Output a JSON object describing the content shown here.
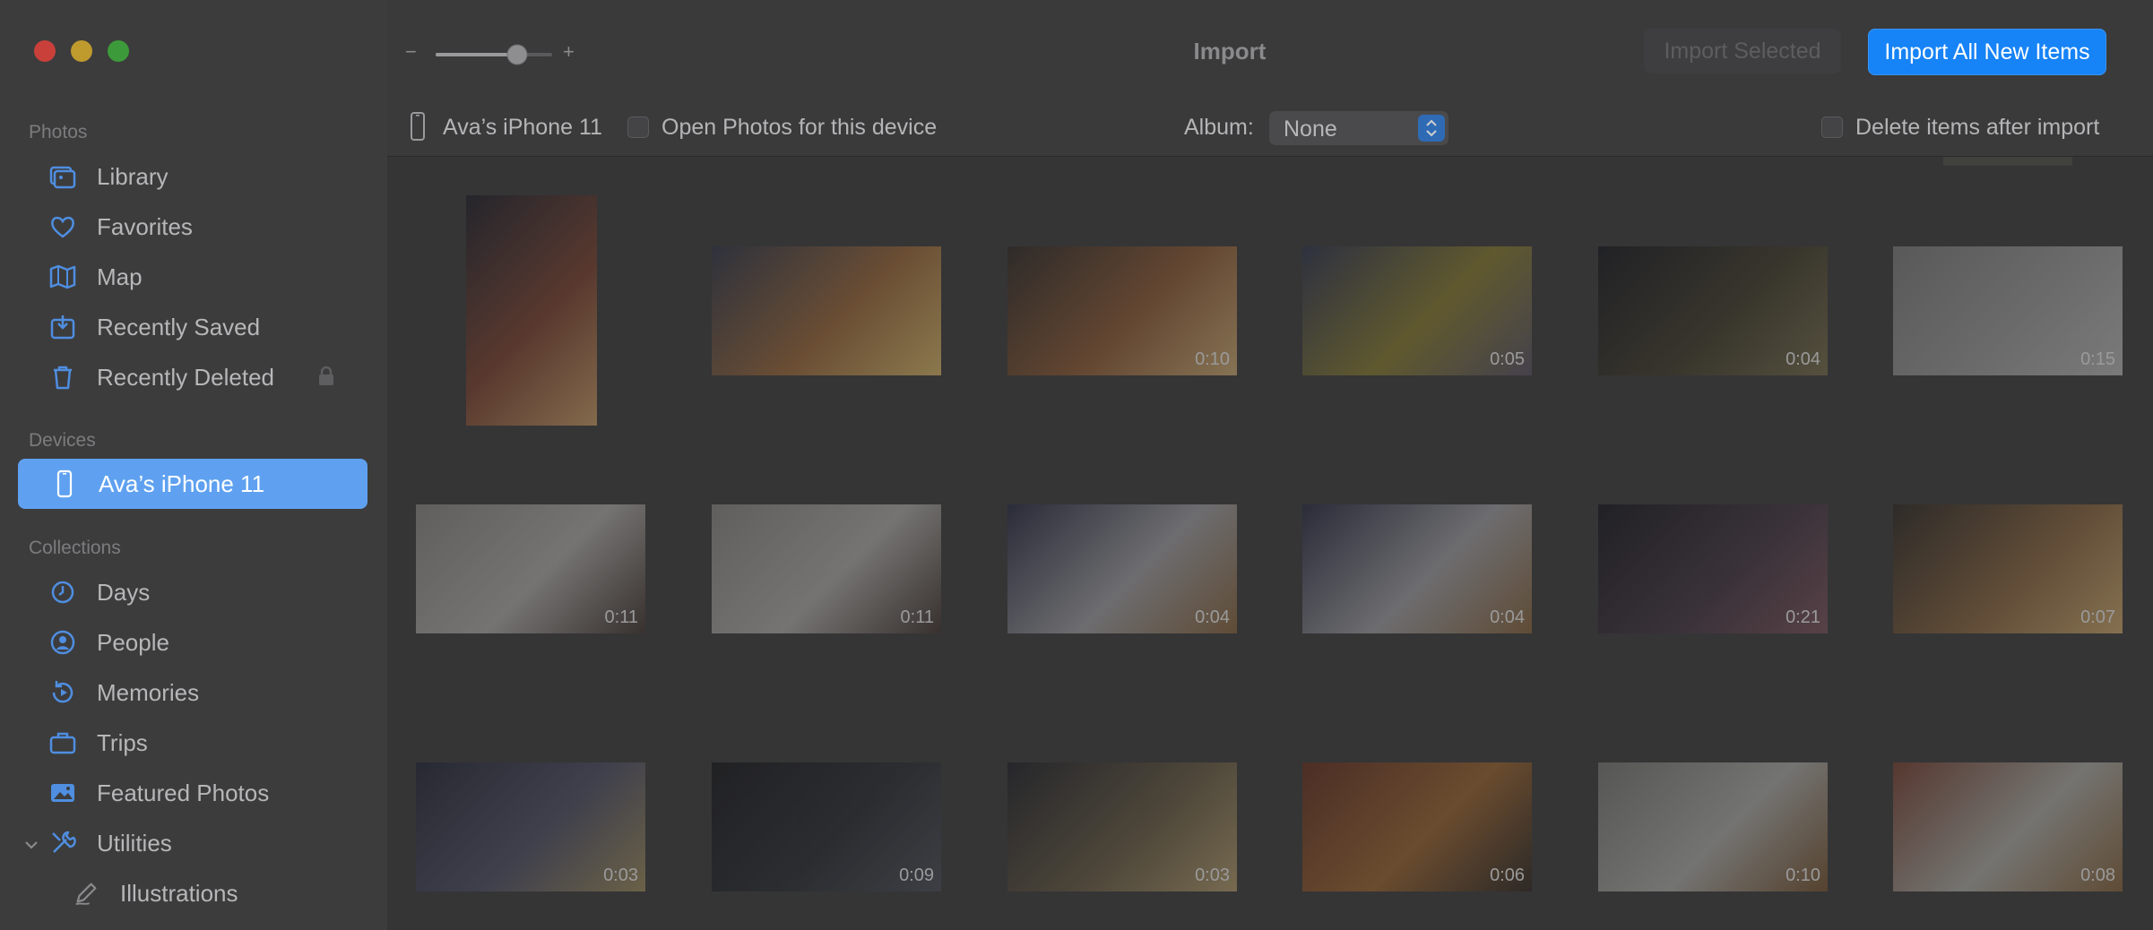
{
  "window": {
    "title": "Import"
  },
  "toolbar": {
    "zoom_minus": "−",
    "zoom_plus": "+",
    "zoom_level": 0.7,
    "import_selected_label": "Import Selected",
    "import_all_label": "Import All New Items"
  },
  "subbar": {
    "device_name": "Ava’s iPhone 11",
    "open_photos_label": "Open Photos for this device",
    "album_label": "Album:",
    "album_value": "None",
    "delete_after_label": "Delete items after import"
  },
  "sidebar": {
    "photos_header": "Photos",
    "photos_items": [
      {
        "label": "Library",
        "icon": "library-icon"
      },
      {
        "label": "Favorites",
        "icon": "heart-icon"
      },
      {
        "label": "Map",
        "icon": "map-icon"
      },
      {
        "label": "Recently Saved",
        "icon": "recently-saved-icon"
      },
      {
        "label": "Recently Deleted",
        "icon": "trash-icon"
      }
    ],
    "devices_header": "Devices",
    "device_item": {
      "label": "Ava’s iPhone 11",
      "icon": "iphone-icon"
    },
    "collections_header": "Collections",
    "collections_items": [
      {
        "label": "Days",
        "icon": "clock-icon"
      },
      {
        "label": "People",
        "icon": "person-icon"
      },
      {
        "label": "Memories",
        "icon": "memories-icon"
      },
      {
        "label": "Trips",
        "icon": "suitcase-icon"
      },
      {
        "label": "Featured Photos",
        "icon": "photo-icon"
      },
      {
        "label": "Utilities",
        "icon": "tools-icon"
      },
      {
        "label": "Illustrations",
        "icon": "pen-icon"
      }
    ]
  },
  "colors": {
    "accent": "#1683f6",
    "selected_sidebar": "#5fa1f0",
    "traffic_red": "#c9403a",
    "traffic_yellow": "#bf9a2d",
    "traffic_green": "#3d9a3a"
  },
  "thumbnails": [
    {
      "duration": "",
      "palette": [
        "#1b1c26",
        "#6e3b2a",
        "#b38a59"
      ]
    },
    {
      "duration": "",
      "palette": [
        "#2b3040",
        "#8a5c33",
        "#c0a25b"
      ]
    },
    {
      "duration": "0:10",
      "palette": [
        "#2a2522",
        "#80512e",
        "#b89967"
      ]
    },
    {
      "duration": "0:05",
      "palette": [
        "#2a2f45",
        "#7a6f2a",
        "#4f4a5a"
      ]
    },
    {
      "duration": "0:04",
      "palette": [
        "#15161c",
        "#3a3526",
        "#6a6244"
      ]
    },
    {
      "duration": "0:15",
      "palette": [
        "#6f6f70",
        "#8b8b8b",
        "#a5a5a5"
      ]
    },
    {
      "duration": "0:11",
      "palette": [
        "#7a7876",
        "#9c9a97",
        "#3a2f2a"
      ]
    },
    {
      "duration": "0:11",
      "palette": [
        "#7a7876",
        "#9c9a97",
        "#3a2f2a"
      ]
    },
    {
      "duration": "0:04",
      "palette": [
        "#23263a",
        "#8f8f93",
        "#7a5a36"
      ]
    },
    {
      "duration": "0:04",
      "palette": [
        "#23263a",
        "#8f8f93",
        "#7a5a36"
      ]
    },
    {
      "duration": "0:21",
      "palette": [
        "#15151b",
        "#3b2f3a",
        "#6d4a52"
      ]
    },
    {
      "duration": "0:07",
      "palette": [
        "#2a2520",
        "#7a5a38",
        "#b79660"
      ]
    },
    {
      "duration": "0:03",
      "palette": [
        "#1f2230",
        "#46475a",
        "#8d7d53"
      ]
    },
    {
      "duration": "0:09",
      "palette": [
        "#141518",
        "#26282e",
        "#44464e"
      ]
    },
    {
      "duration": "0:03",
      "palette": [
        "#1d1e24",
        "#5b503b",
        "#9f8b61"
      ]
    },
    {
      "duration": "0:06",
      "palette": [
        "#5a2a1c",
        "#8a5a2a",
        "#2a2420"
      ]
    },
    {
      "duration": "0:10",
      "palette": [
        "#6a6a68",
        "#9a9a96",
        "#6a4a2a"
      ]
    },
    {
      "duration": "0:08",
      "palette": [
        "#6a3a2c",
        "#9a9a94",
        "#7a5a36"
      ]
    }
  ]
}
